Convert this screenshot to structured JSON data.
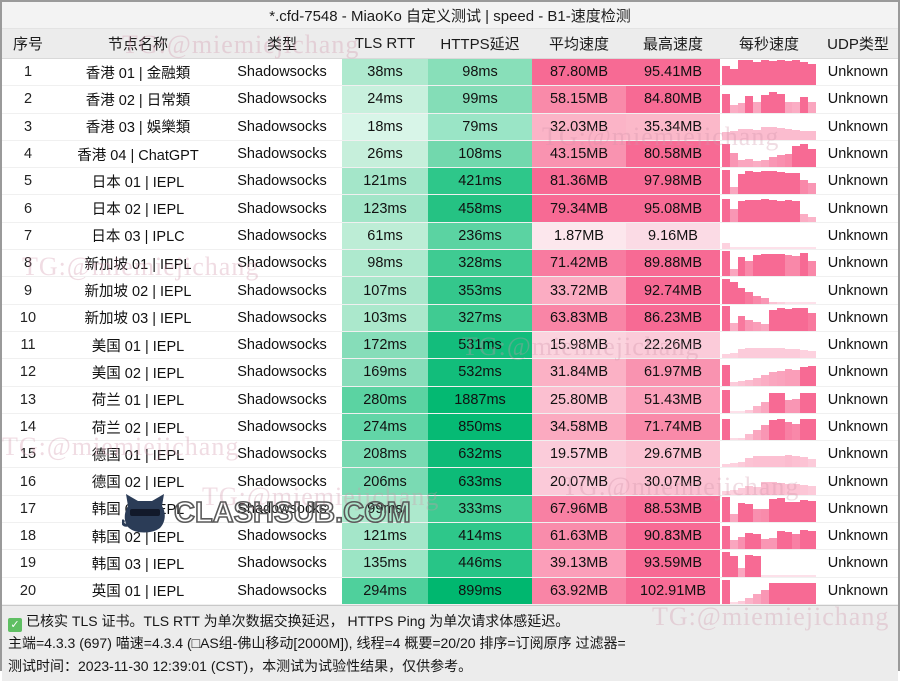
{
  "window": {
    "title": "*.cfd-7548 - MiaoKo 自定义测试 | speed - B1-速度检测"
  },
  "table": {
    "headers": [
      "序号",
      "节点名称",
      "类型",
      "TLS RTT",
      "HTTPS延迟",
      "平均速度",
      "最高速度",
      "每秒速度",
      "UDP类型"
    ],
    "rows": [
      {
        "idx": "1",
        "name": "香港 01 | 金融類",
        "type": "Shadowsocks",
        "rtt": "38ms",
        "ping": "98ms",
        "avg": "87.80MB",
        "max": "95.41MB",
        "udp": "Unknown",
        "spark": [
          0.75,
          0.62,
          0.95,
          0.98,
          0.9,
          0.98,
          0.93,
          0.95,
          0.92,
          0.98,
          0.88,
          0.82
        ],
        "spark_alpha": [
          1,
          1,
          1,
          1,
          1,
          1,
          1,
          1,
          1,
          1,
          1,
          1
        ],
        "rtt_bg": "#aee9ce",
        "ping_bg": "#88dfb9",
        "avg_bg": "#f76a94",
        "max_bg": "#f76a94"
      },
      {
        "idx": "2",
        "name": "香港 02 | 日常類",
        "type": "Shadowsocks",
        "rtt": "24ms",
        "ping": "99ms",
        "avg": "58.15MB",
        "max": "84.80MB",
        "udp": "Unknown",
        "spark": [
          0.7,
          0.3,
          0.38,
          0.62,
          0.4,
          0.68,
          0.78,
          0.7,
          0.42,
          0.4,
          0.58,
          0.42
        ],
        "spark_alpha": [
          1,
          0.55,
          0.6,
          1,
          0.6,
          1,
          1,
          1,
          0.6,
          0.55,
          1,
          0.6
        ],
        "rtt_bg": "#c8f0dd",
        "ping_bg": "#84ddb7",
        "avg_bg": "#f98aa9",
        "max_bg": "#f76a94"
      },
      {
        "idx": "3",
        "name": "香港 03 | 娛樂類",
        "type": "Shadowsocks",
        "rtt": "18ms",
        "ping": "79ms",
        "avg": "32.03MB",
        "max": "35.34MB",
        "udp": "Unknown",
        "spark": [
          0.3,
          0.32,
          0.4,
          0.42,
          0.38,
          0.5,
          0.48,
          0.46,
          0.4,
          0.36,
          0.34,
          0.32
        ],
        "spark_alpha": [
          0.45,
          0.45,
          0.45,
          0.45,
          0.45,
          0.45,
          0.45,
          0.45,
          0.45,
          0.45,
          0.45,
          0.45
        ],
        "rtt_bg": "#d8f5e8",
        "ping_bg": "#9ae5c6",
        "avg_bg": "#fbb4c7",
        "max_bg": "#fbb8c9"
      },
      {
        "idx": "4",
        "name": "香港 04 | ChatGPT",
        "type": "Shadowsocks",
        "rtt": "26ms",
        "ping": "108ms",
        "avg": "43.15MB",
        "max": "80.58MB",
        "udp": "Unknown",
        "spark": [
          0.9,
          0.55,
          0.28,
          0.3,
          0.22,
          0.26,
          0.4,
          0.48,
          0.52,
          0.8,
          0.88,
          0.7
        ],
        "spark_alpha": [
          1,
          0.7,
          0.6,
          0.6,
          0.55,
          0.6,
          0.7,
          0.75,
          0.8,
          1,
          1,
          1
        ],
        "rtt_bg": "#c6efdb",
        "ping_bg": "#72d8ad",
        "avg_bg": "#f993b0",
        "max_bg": "#f76a94"
      },
      {
        "idx": "5",
        "name": "日本 01 | IEPL",
        "type": "Shadowsocks",
        "rtt": "121ms",
        "ping": "421ms",
        "avg": "81.36MB",
        "max": "97.98MB",
        "udp": "Unknown",
        "spark": [
          0.92,
          0.3,
          0.78,
          0.88,
          0.86,
          0.9,
          0.88,
          0.86,
          0.82,
          0.8,
          0.56,
          0.42
        ],
        "spark_alpha": [
          1,
          0.6,
          1,
          1,
          1,
          1,
          1,
          1,
          1,
          1,
          0.8,
          0.7
        ],
        "rtt_bg": "#a4e6c9",
        "ping_bg": "#2ec78a",
        "avg_bg": "#f76a94",
        "max_bg": "#f76a94"
      },
      {
        "idx": "6",
        "name": "日本 02 | IEPL",
        "type": "Shadowsocks",
        "rtt": "123ms",
        "ping": "458ms",
        "avg": "79.34MB",
        "max": "95.08MB",
        "udp": "Unknown",
        "spark": [
          0.88,
          0.5,
          0.8,
          0.84,
          0.82,
          0.86,
          0.84,
          0.8,
          0.82,
          0.78,
          0.3,
          0.18
        ],
        "spark_alpha": [
          1,
          0.7,
          1,
          1,
          1,
          1,
          1,
          1,
          1,
          1,
          0.55,
          0.5
        ],
        "rtt_bg": "#a2e5c8",
        "ping_bg": "#25c283",
        "avg_bg": "#f76a94",
        "max_bg": "#f76a94"
      },
      {
        "idx": "7",
        "name": "日本 03 | IPLC",
        "type": "Shadowsocks",
        "rtt": "61ms",
        "ping": "236ms",
        "avg": "1.87MB",
        "max": "9.16MB",
        "udp": "Unknown",
        "spark": [
          0.22,
          0.06,
          0.04,
          0.04,
          0.04,
          0.04,
          0.04,
          0.04,
          0.04,
          0.04,
          0.04,
          0.04
        ],
        "spark_alpha": [
          0.3,
          0.2,
          0.2,
          0.2,
          0.2,
          0.2,
          0.2,
          0.2,
          0.2,
          0.2,
          0.2,
          0.2
        ],
        "rtt_bg": "#bdedd6",
        "ping_bg": "#5bd3a2",
        "avg_bg": "#fce7ed",
        "max_bg": "#fbdbe5"
      },
      {
        "idx": "8",
        "name": "新加坡 01 | IEPL",
        "type": "Shadowsocks",
        "rtt": "98ms",
        "ping": "328ms",
        "avg": "71.42MB",
        "max": "89.88MB",
        "udp": "Unknown",
        "spark": [
          0.96,
          0.3,
          0.72,
          0.6,
          0.8,
          0.84,
          0.86,
          0.86,
          0.8,
          0.78,
          0.88,
          0.6
        ],
        "spark_alpha": [
          1,
          0.6,
          1,
          0.8,
          1,
          1,
          1,
          1,
          0.8,
          0.8,
          1,
          0.8
        ],
        "rtt_bg": "#aee9ce",
        "ping_bg": "#3fcb92",
        "avg_bg": "#f87ba0",
        "max_bg": "#f76a94"
      },
      {
        "idx": "9",
        "name": "新加坡 02 | IEPL",
        "type": "Shadowsocks",
        "rtt": "107ms",
        "ping": "353ms",
        "avg": "33.72MB",
        "max": "92.74MB",
        "udp": "Unknown",
        "spark": [
          0.95,
          0.82,
          0.6,
          0.44,
          0.3,
          0.22,
          0.08,
          0.04,
          0.03,
          0.03,
          0.03,
          0.03
        ],
        "spark_alpha": [
          1,
          1,
          1,
          0.9,
          0.8,
          0.7,
          0.4,
          0.3,
          0.2,
          0.2,
          0.2,
          0.2
        ],
        "rtt_bg": "#a9e7cb",
        "ping_bg": "#34c78c",
        "avg_bg": "#fbacc2",
        "max_bg": "#f76a94"
      },
      {
        "idx": "10",
        "name": "新加坡 03 | IEPL",
        "type": "Shadowsocks",
        "rtt": "103ms",
        "ping": "327ms",
        "avg": "63.83MB",
        "max": "86.23MB",
        "udp": "Unknown",
        "spark": [
          0.95,
          0.32,
          0.58,
          0.4,
          0.36,
          0.28,
          0.78,
          0.88,
          0.84,
          0.86,
          0.86,
          0.7
        ],
        "spark_alpha": [
          1,
          0.55,
          0.9,
          0.7,
          0.65,
          0.6,
          1,
          1,
          1,
          1,
          1,
          0.9
        ],
        "rtt_bg": "#abe8cc",
        "ping_bg": "#40cb92",
        "avg_bg": "#f985a6",
        "max_bg": "#f76a94"
      },
      {
        "idx": "11",
        "name": "美国 01 | IEPL",
        "type": "Shadowsocks",
        "rtt": "172ms",
        "ping": "531ms",
        "avg": "15.98MB",
        "max": "22.26MB",
        "udp": "Unknown",
        "spark": [
          0.18,
          0.2,
          0.36,
          0.4,
          0.38,
          0.4,
          0.38,
          0.38,
          0.36,
          0.34,
          0.3,
          0.28
        ],
        "spark_alpha": [
          0.3,
          0.3,
          0.35,
          0.35,
          0.35,
          0.35,
          0.35,
          0.35,
          0.35,
          0.35,
          0.3,
          0.3
        ],
        "rtt_bg": "#86ddb9",
        "ping_bg": "#13bd7c",
        "avg_bg": "#fbd3de",
        "max_bg": "#fbcbd9"
      },
      {
        "idx": "12",
        "name": "美国 02 | IEPL",
        "type": "Shadowsocks",
        "rtt": "169ms",
        "ping": "532ms",
        "avg": "31.84MB",
        "max": "61.97MB",
        "udp": "Unknown",
        "spark": [
          0.8,
          0.12,
          0.16,
          0.22,
          0.3,
          0.4,
          0.5,
          0.56,
          0.62,
          0.6,
          0.72,
          0.74
        ],
        "spark_alpha": [
          1,
          0.35,
          0.4,
          0.45,
          0.5,
          0.55,
          0.6,
          0.62,
          0.65,
          0.65,
          1,
          1
        ],
        "rtt_bg": "#88ddba",
        "ping_bg": "#12bd7b",
        "avg_bg": "#fbb1c5",
        "max_bg": "#f993b0"
      },
      {
        "idx": "13",
        "name": "荷兰 01 | IEPL",
        "type": "Shadowsocks",
        "rtt": "280ms",
        "ping": "1887ms",
        "avg": "25.80MB",
        "max": "51.43MB",
        "udp": "Unknown",
        "spark": [
          0.86,
          0.04,
          0.04,
          0.1,
          0.26,
          0.4,
          0.74,
          0.76,
          0.5,
          0.52,
          0.76,
          0.74
        ],
        "spark_alpha": [
          1,
          0.2,
          0.2,
          0.35,
          0.5,
          0.6,
          1,
          1,
          0.7,
          0.7,
          1,
          1
        ],
        "rtt_bg": "#5bd3a2",
        "ping_bg": "#04b972",
        "avg_bg": "#fbbfd0",
        "max_bg": "#fba0ba"
      },
      {
        "idx": "14",
        "name": "荷兰 02 | IEPL",
        "type": "Shadowsocks",
        "rtt": "274ms",
        "ping": "850ms",
        "avg": "34.58MB",
        "max": "71.74MB",
        "udp": "Unknown",
        "spark": [
          0.82,
          0.06,
          0.08,
          0.22,
          0.4,
          0.58,
          0.78,
          0.8,
          0.68,
          0.62,
          0.82,
          0.8
        ],
        "spark_alpha": [
          1,
          0.25,
          0.3,
          0.45,
          0.6,
          0.7,
          1,
          1,
          0.85,
          0.8,
          1,
          1
        ],
        "rtt_bg": "#62d5a7",
        "ping_bg": "#06ba74",
        "avg_bg": "#fbaac0",
        "max_bg": "#f98aa9"
      },
      {
        "idx": "15",
        "name": "德国 01 | IEPL",
        "type": "Shadowsocks",
        "rtt": "208ms",
        "ping": "632ms",
        "avg": "19.57MB",
        "max": "29.67MB",
        "udp": "Unknown",
        "spark": [
          0.14,
          0.16,
          0.22,
          0.36,
          0.42,
          0.44,
          0.44,
          0.42,
          0.46,
          0.42,
          0.4,
          0.34
        ],
        "spark_alpha": [
          0.3,
          0.3,
          0.35,
          0.4,
          0.42,
          0.42,
          0.42,
          0.42,
          0.45,
          0.42,
          0.4,
          0.35
        ],
        "rtt_bg": "#79daB2",
        "ping_bg": "#0dbb78",
        "avg_bg": "#fbccda",
        "max_bg": "#fbc2d2"
      },
      {
        "idx": "16",
        "name": "德国 02 | IEPL",
        "type": "Shadowsocks",
        "rtt": "206ms",
        "ping": "633ms",
        "avg": "20.07MB",
        "max": "30.07MB",
        "udp": "Unknown",
        "spark": [
          0.16,
          0.18,
          0.26,
          0.32,
          0.3,
          0.48,
          0.5,
          0.46,
          0.42,
          0.4,
          0.38,
          0.34
        ],
        "spark_alpha": [
          0.3,
          0.3,
          0.35,
          0.38,
          0.36,
          0.45,
          0.46,
          0.44,
          0.4,
          0.4,
          0.38,
          0.35
        ],
        "rtt_bg": "#7adab3",
        "ping_bg": "#0dbb78",
        "avg_bg": "#fbcad9",
        "max_bg": "#fbc0d1"
      },
      {
        "idx": "17",
        "name": "韩国 01 | IEPL",
        "type": "Shadowsocks",
        "rtt": "99ms",
        "ping": "333ms",
        "avg": "67.96MB",
        "max": "88.53MB",
        "udp": "Unknown",
        "spark": [
          0.96,
          0.3,
          0.72,
          0.7,
          0.48,
          0.5,
          0.86,
          0.9,
          0.78,
          0.76,
          0.84,
          0.8
        ],
        "spark_alpha": [
          1,
          0.6,
          1,
          1,
          0.75,
          0.78,
          1,
          1,
          1,
          1,
          1,
          1
        ],
        "rtt_bg": "#ade9cd",
        "ping_bg": "#3ecb91",
        "avg_bg": "#f880a3",
        "max_bg": "#f76a94"
      },
      {
        "idx": "18",
        "name": "韩国 02 | IEPL",
        "type": "Shadowsocks",
        "rtt": "121ms",
        "ping": "414ms",
        "avg": "61.63MB",
        "max": "90.83MB",
        "udp": "Unknown",
        "spark": [
          0.9,
          0.36,
          0.46,
          0.62,
          0.6,
          0.4,
          0.42,
          0.68,
          0.66,
          0.58,
          0.72,
          0.7
        ],
        "spark_alpha": [
          1,
          0.6,
          0.75,
          1,
          1,
          0.7,
          0.7,
          1,
          1,
          0.85,
          1,
          1
        ],
        "rtt_bg": "#a4e6c9",
        "ping_bg": "#2ec78a",
        "avg_bg": "#f98cab",
        "max_bg": "#f76a94"
      },
      {
        "idx": "19",
        "name": "韩国 03 | IEPL",
        "type": "Shadowsocks",
        "rtt": "135ms",
        "ping": "446ms",
        "avg": "39.13MB",
        "max": "93.59MB",
        "udp": "Unknown",
        "spark": [
          0.92,
          0.8,
          0.32,
          0.82,
          0.8,
          0.04,
          0.03,
          0.03,
          0.03,
          0.03,
          0.03,
          0.03
        ],
        "spark_alpha": [
          1,
          1,
          0.6,
          1,
          1,
          0.2,
          0.2,
          0.2,
          0.2,
          0.2,
          0.2,
          0.2
        ],
        "rtt_bg": "#9ce5c5",
        "ping_bg": "#28c587",
        "avg_bg": "#fb9eb9",
        "max_bg": "#f76a94"
      },
      {
        "idx": "20",
        "name": "英国 01 | IEPL",
        "type": "Shadowsocks",
        "rtt": "294ms",
        "ping": "899ms",
        "avg": "63.92MB",
        "max": "102.91MB",
        "udp": "Unknown",
        "spark": [
          0.9,
          0.06,
          0.1,
          0.22,
          0.36,
          0.52,
          0.78,
          0.8,
          0.8,
          0.78,
          0.8,
          0.78
        ],
        "spark_alpha": [
          1,
          0.25,
          0.35,
          0.5,
          0.6,
          0.7,
          1,
          1,
          1,
          1,
          1,
          1
        ],
        "rtt_bg": "#4fd09c",
        "ping_bg": "#00b76f",
        "avg_bg": "#f985a6",
        "max_bg": "#f76a94"
      }
    ]
  },
  "footer": {
    "check_glyph": "✓",
    "line1": "已核实 TLS 证书。TLS RTT 为单次数据交换延迟， HTTPS Ping 为单次请求体感延迟。",
    "line2": "主端=4.3.3 (697) 喵速=4.3.4 (□AS组-佛山移动[2000M]), 线程=4 概要=20/20 排序=订阅原序 过滤器=",
    "line3": "测试时间：2023-11-30 12:39:01 (CST)，本测试为试验性结果，仅供参考。"
  },
  "watermarks": {
    "text": "TG:@miemiejichang",
    "logo_text": "CLASHSUB.COM"
  }
}
